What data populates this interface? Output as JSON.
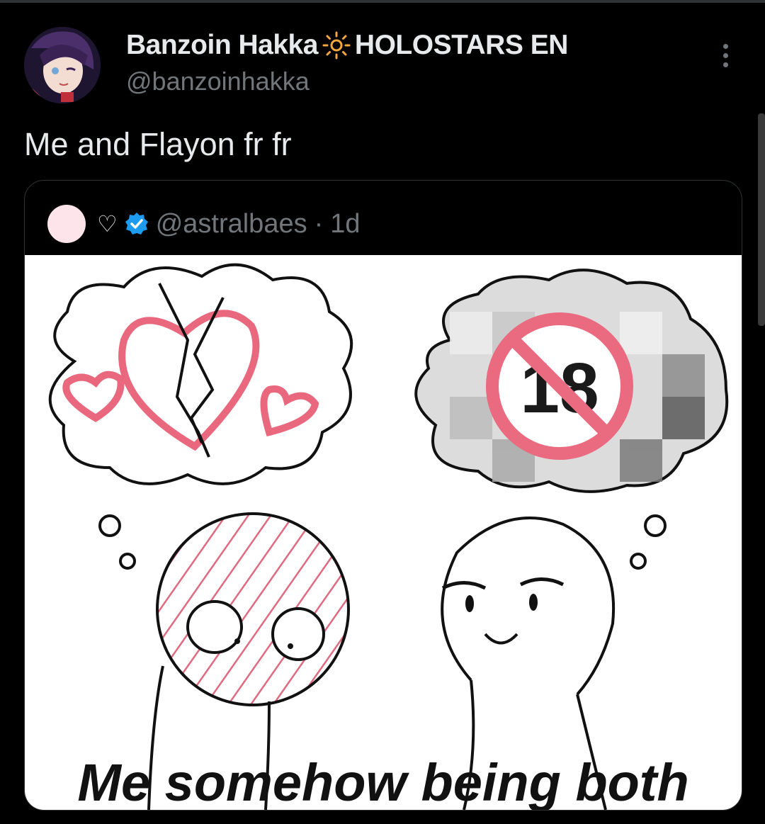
{
  "tweet": {
    "author_name": "Banzoin Hakka",
    "author_name_suffix": "HOLOSTARS EN",
    "author_handle": "@banzoinhakka",
    "text": "Me and Flayon fr fr",
    "icons": {
      "badge": "sun-icon",
      "menu": "more-options-icon"
    }
  },
  "quote": {
    "heart": "♡",
    "handle": "@astralbaes",
    "separator": "·",
    "time": "1d",
    "verified_color": "#1d9bf0",
    "image": {
      "caption": "Me somehow being both",
      "sign_number": "18"
    }
  },
  "colors": {
    "background": "#000000",
    "text": "#e7e9ea",
    "muted": "#71767b",
    "accent_pink": "#ec6f82",
    "sun_orange": "#f4a641"
  }
}
